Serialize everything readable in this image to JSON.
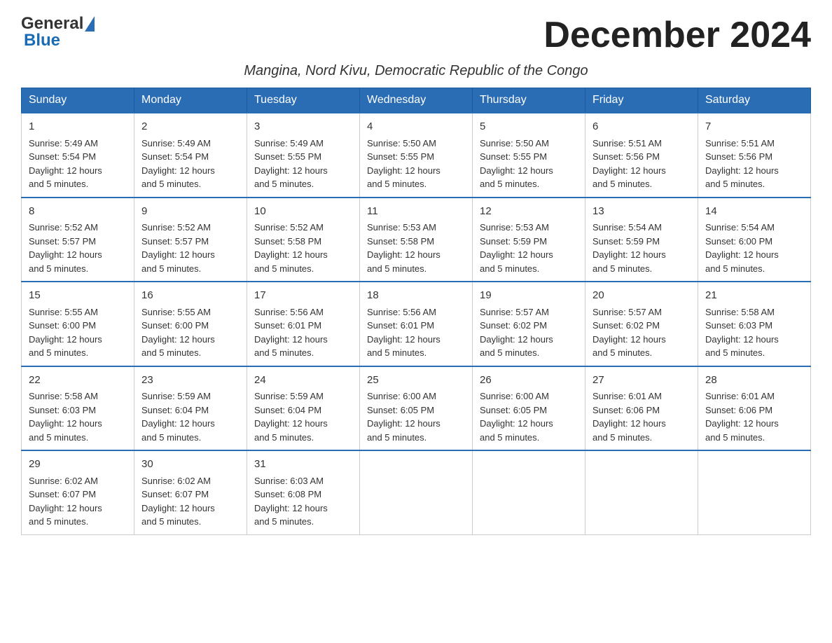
{
  "logo": {
    "text_general": "General",
    "text_blue": "Blue"
  },
  "header": {
    "month_title": "December 2024",
    "subtitle": "Mangina, Nord Kivu, Democratic Republic of the Congo"
  },
  "weekdays": [
    "Sunday",
    "Monday",
    "Tuesday",
    "Wednesday",
    "Thursday",
    "Friday",
    "Saturday"
  ],
  "weeks": [
    [
      {
        "day": "1",
        "sunrise": "5:49 AM",
        "sunset": "5:54 PM",
        "daylight": "12 hours and 5 minutes."
      },
      {
        "day": "2",
        "sunrise": "5:49 AM",
        "sunset": "5:54 PM",
        "daylight": "12 hours and 5 minutes."
      },
      {
        "day": "3",
        "sunrise": "5:49 AM",
        "sunset": "5:55 PM",
        "daylight": "12 hours and 5 minutes."
      },
      {
        "day": "4",
        "sunrise": "5:50 AM",
        "sunset": "5:55 PM",
        "daylight": "12 hours and 5 minutes."
      },
      {
        "day": "5",
        "sunrise": "5:50 AM",
        "sunset": "5:55 PM",
        "daylight": "12 hours and 5 minutes."
      },
      {
        "day": "6",
        "sunrise": "5:51 AM",
        "sunset": "5:56 PM",
        "daylight": "12 hours and 5 minutes."
      },
      {
        "day": "7",
        "sunrise": "5:51 AM",
        "sunset": "5:56 PM",
        "daylight": "12 hours and 5 minutes."
      }
    ],
    [
      {
        "day": "8",
        "sunrise": "5:52 AM",
        "sunset": "5:57 PM",
        "daylight": "12 hours and 5 minutes."
      },
      {
        "day": "9",
        "sunrise": "5:52 AM",
        "sunset": "5:57 PM",
        "daylight": "12 hours and 5 minutes."
      },
      {
        "day": "10",
        "sunrise": "5:52 AM",
        "sunset": "5:58 PM",
        "daylight": "12 hours and 5 minutes."
      },
      {
        "day": "11",
        "sunrise": "5:53 AM",
        "sunset": "5:58 PM",
        "daylight": "12 hours and 5 minutes."
      },
      {
        "day": "12",
        "sunrise": "5:53 AM",
        "sunset": "5:59 PM",
        "daylight": "12 hours and 5 minutes."
      },
      {
        "day": "13",
        "sunrise": "5:54 AM",
        "sunset": "5:59 PM",
        "daylight": "12 hours and 5 minutes."
      },
      {
        "day": "14",
        "sunrise": "5:54 AM",
        "sunset": "6:00 PM",
        "daylight": "12 hours and 5 minutes."
      }
    ],
    [
      {
        "day": "15",
        "sunrise": "5:55 AM",
        "sunset": "6:00 PM",
        "daylight": "12 hours and 5 minutes."
      },
      {
        "day": "16",
        "sunrise": "5:55 AM",
        "sunset": "6:00 PM",
        "daylight": "12 hours and 5 minutes."
      },
      {
        "day": "17",
        "sunrise": "5:56 AM",
        "sunset": "6:01 PM",
        "daylight": "12 hours and 5 minutes."
      },
      {
        "day": "18",
        "sunrise": "5:56 AM",
        "sunset": "6:01 PM",
        "daylight": "12 hours and 5 minutes."
      },
      {
        "day": "19",
        "sunrise": "5:57 AM",
        "sunset": "6:02 PM",
        "daylight": "12 hours and 5 minutes."
      },
      {
        "day": "20",
        "sunrise": "5:57 AM",
        "sunset": "6:02 PM",
        "daylight": "12 hours and 5 minutes."
      },
      {
        "day": "21",
        "sunrise": "5:58 AM",
        "sunset": "6:03 PM",
        "daylight": "12 hours and 5 minutes."
      }
    ],
    [
      {
        "day": "22",
        "sunrise": "5:58 AM",
        "sunset": "6:03 PM",
        "daylight": "12 hours and 5 minutes."
      },
      {
        "day": "23",
        "sunrise": "5:59 AM",
        "sunset": "6:04 PM",
        "daylight": "12 hours and 5 minutes."
      },
      {
        "day": "24",
        "sunrise": "5:59 AM",
        "sunset": "6:04 PM",
        "daylight": "12 hours and 5 minutes."
      },
      {
        "day": "25",
        "sunrise": "6:00 AM",
        "sunset": "6:05 PM",
        "daylight": "12 hours and 5 minutes."
      },
      {
        "day": "26",
        "sunrise": "6:00 AM",
        "sunset": "6:05 PM",
        "daylight": "12 hours and 5 minutes."
      },
      {
        "day": "27",
        "sunrise": "6:01 AM",
        "sunset": "6:06 PM",
        "daylight": "12 hours and 5 minutes."
      },
      {
        "day": "28",
        "sunrise": "6:01 AM",
        "sunset": "6:06 PM",
        "daylight": "12 hours and 5 minutes."
      }
    ],
    [
      {
        "day": "29",
        "sunrise": "6:02 AM",
        "sunset": "6:07 PM",
        "daylight": "12 hours and 5 minutes."
      },
      {
        "day": "30",
        "sunrise": "6:02 AM",
        "sunset": "6:07 PM",
        "daylight": "12 hours and 5 minutes."
      },
      {
        "day": "31",
        "sunrise": "6:03 AM",
        "sunset": "6:08 PM",
        "daylight": "12 hours and 5 minutes."
      },
      {
        "day": "",
        "sunrise": "",
        "sunset": "",
        "daylight": ""
      },
      {
        "day": "",
        "sunrise": "",
        "sunset": "",
        "daylight": ""
      },
      {
        "day": "",
        "sunrise": "",
        "sunset": "",
        "daylight": ""
      },
      {
        "day": "",
        "sunrise": "",
        "sunset": "",
        "daylight": ""
      }
    ]
  ],
  "labels": {
    "sunrise": "Sunrise:",
    "sunset": "Sunset:",
    "daylight": "Daylight:"
  }
}
